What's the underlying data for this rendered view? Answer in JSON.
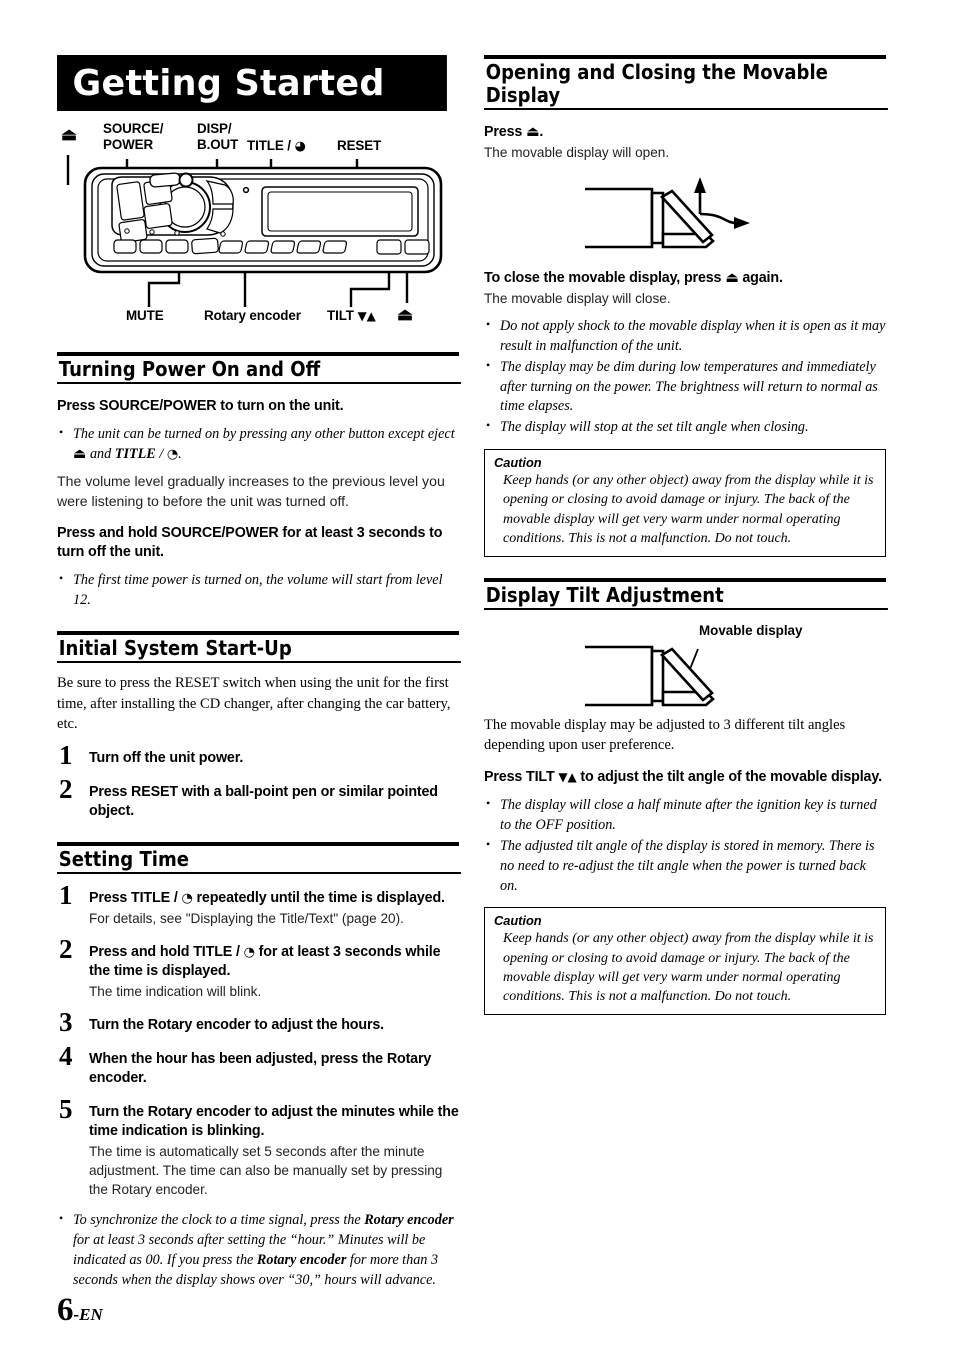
{
  "banner": {
    "title": "Getting Started"
  },
  "unit_diagram": {
    "callouts_top": [
      {
        "label": "⏏",
        "name": "eject-callout"
      },
      {
        "label": "SOURCE/\nPOWER",
        "name": "source-power-callout"
      },
      {
        "label": "DISP/\nB.OUT",
        "name": "disp-bout-callout"
      },
      {
        "label": "TITLE / ◔",
        "name": "title-clock-callout"
      },
      {
        "label": "RESET",
        "name": "reset-callout"
      }
    ],
    "callouts_bottom": [
      {
        "label": "MUTE",
        "name": "mute-callout"
      },
      {
        "label": "Rotary encoder",
        "name": "rotary-encoder-callout"
      },
      {
        "label": "TILT ▼▲",
        "name": "tilt-callout"
      },
      {
        "label": "⏏",
        "name": "eject-bottom-callout"
      }
    ]
  },
  "left_column": {
    "turning_power": {
      "heading": "Turning Power On and Off",
      "lead1_a": "Press ",
      "lead1_b": "SOURCE/POWER",
      "lead1_c": " to turn on the unit.",
      "note1_a": "The unit can be turned on by pressing any other button except eject ",
      "note1_b": "⏏",
      "note1_c": " and ",
      "note1_d": "TITLE",
      "note1_e": " / ",
      "note1_f": "◔",
      "note1_g": ".",
      "para1": "The volume level gradually increases to the previous level you were listening to before the unit was turned off.",
      "lead2_a": "Press and hold ",
      "lead2_b": "SOURCE/POWER",
      "lead2_c": " for at least 3 seconds to turn off the unit.",
      "note2": "The first time power is turned on, the volume will start from level 12."
    },
    "initial_startup": {
      "heading": "Initial System Start-Up",
      "intro": "Be sure to press the RESET switch when using the unit for the first time, after installing the CD changer, after changing the car battery, etc.",
      "steps": [
        {
          "num": "1",
          "title_a": "Turn off the unit power.",
          "title_b": "",
          "title_c": ""
        },
        {
          "num": "2",
          "title_a": "Press ",
          "title_b": "RESET",
          "title_c": " with a ball-point pen or similar pointed object."
        }
      ]
    },
    "setting_time": {
      "heading": "Setting Time",
      "step1": {
        "num": "1",
        "a": "Press ",
        "b": "TITLE",
        "c": " / ",
        "d": "◔",
        "e": " repeatedly until the time is displayed.",
        "desc": "For details, see \"Displaying the Title/Text\" (page 20)."
      },
      "step2": {
        "num": "2",
        "a": "Press and hold ",
        "b": "TITLE",
        "c": " / ",
        "d": "◔",
        "e": " for at least 3 seconds while the time is displayed.",
        "desc": "The time indication will blink."
      },
      "step3": {
        "num": "3",
        "a": "Turn the ",
        "b": "Rotary encoder",
        "c": " to adjust the hours.",
        "desc": ""
      },
      "step4": {
        "num": "4",
        "a": "When the hour has been adjusted, press the ",
        "b": "Rotary encoder",
        "c": ".",
        "desc": ""
      },
      "step5": {
        "num": "5",
        "a": "Turn the ",
        "b": "Rotary encoder",
        "c": " to adjust the minutes while the time indication is blinking.",
        "desc": "The time is automatically set 5 seconds after the minute adjustment. The time can also be manually set by pressing the Rotary encoder."
      },
      "final_note_a": "To synchronize the clock to a time signal, press the ",
      "final_note_b": "Rotary encoder",
      "final_note_c": " for at least 3 seconds after setting the “hour.” Minutes will be indicated as 00.  If you press the ",
      "final_note_d": "Rotary encoder",
      "final_note_e": " for more than 3 seconds when the display shows over “30,” hours will advance."
    }
  },
  "right_column": {
    "opening_closing": {
      "heading": "Opening and Closing the Movable Display",
      "lead1_a": "Press ",
      "lead1_b": "⏏",
      "lead1_c": ".",
      "sub1": "The movable display will open.",
      "lead2_a": "To close the movable display, press ",
      "lead2_b": "⏏",
      "lead2_c": " again.",
      "sub2": "The movable display will close.",
      "notes": [
        "Do not apply shock to the movable display when it is open as it may result in malfunction of the unit.",
        "The display may be dim during low temperatures and immediately after turning on the power. The brightness will return to normal as time elapses.",
        "The display will stop at the set tilt angle when closing."
      ],
      "caution_title": "Caution",
      "caution_body": "Keep hands (or any other object) away from the display while it is opening or closing to avoid damage or injury. The back of the movable display will get very warm under normal operating conditions. This is not a malfunction. Do not touch."
    },
    "tilt_adjustment": {
      "heading": "Display Tilt Adjustment",
      "diagram_label": "Movable display",
      "intro": "The movable display may be adjusted to 3 different tilt angles depending upon user preference.",
      "lead_a": "Press ",
      "lead_b": "TILT ",
      "lead_c": "▼▲",
      "lead_d": " to adjust the tilt angle of the movable display.",
      "notes": [
        "The display will close a half minute after the ignition key is turned to the OFF position.",
        "The adjusted tilt angle of the display is stored in memory. There is no need to re-adjust the tilt angle when the power is turned back on."
      ],
      "caution_title": "Caution",
      "caution_body": "Keep hands (or any other object) away from the display while it is opening or closing to avoid damage or injury. The back of the movable display will get very warm under normal operating conditions. This is not a malfunction. Do not touch."
    }
  },
  "footer": {
    "page_number": "6",
    "lang": "-EN"
  }
}
